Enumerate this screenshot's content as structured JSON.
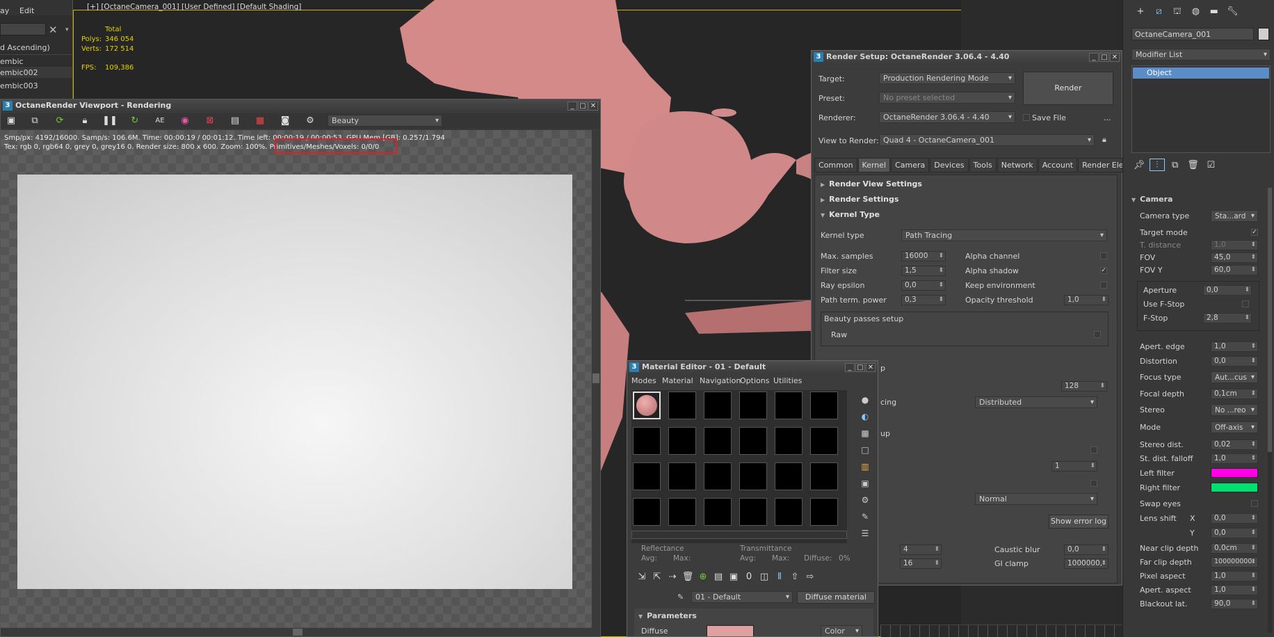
{
  "left_panel": {
    "menu": [
      "ay",
      "Edit"
    ],
    "sort_label": "d Ascending)",
    "items": [
      "embic",
      "embic002",
      "embic003"
    ]
  },
  "viewport": {
    "header": "[+] [OctaneCamera_001] [User Defined] [Default Shading]",
    "stats_total": "Total",
    "polys_label": "Polys:",
    "polys_value": "346 054",
    "verts_label": "Verts:",
    "verts_value": "172 514",
    "fps_label": "FPS:",
    "fps_value": "109,386"
  },
  "octane_viewport": {
    "title": "OctaneRender Viewport - Rendering",
    "pass": "Beauty",
    "stats_line1": "Smp/px: 4192/16000.   Samp/s: 106.6M.   Time: 00:00:19 / 00:01:12.   Time left: 00:00:19 / 00:00:53.   GPU Mem [GB]: 0.257/1.794",
    "stats_line2": "Tex: rgb 0, rgb64 0, grey 0, grey16 0.    Render size: 800 x 600.    Zoom: 100%.    Primitives/Meshes/Voxels: 0/0/0"
  },
  "render_setup": {
    "title": "Render Setup: OctaneRender 3.06.4 - 4.40",
    "target_label": "Target:",
    "target_value": "Production Rendering Mode",
    "preset_label": "Preset:",
    "preset_value": "No preset selected",
    "renderer_label": "Renderer:",
    "renderer_value": "OctaneRender 3.06.4 - 4.40",
    "save_file": "Save File",
    "view_label": "View to Render:",
    "view_value": "Quad 4 - OctaneCamera_001",
    "render_button": "Render",
    "more": "...",
    "tabs": [
      "Common",
      "Kernel",
      "Camera",
      "Devices",
      "Tools",
      "Network",
      "Account",
      "Render Elements"
    ],
    "sections": {
      "view_settings": "Render View Settings",
      "render_settings": "Render Settings",
      "kernel_type": "Kernel Type"
    },
    "kernel_type_label": "Kernel type",
    "kernel_type_value": "Path Tracing",
    "max_samples_label": "Max. samples",
    "max_samples": "16000",
    "filter_size_label": "Filter size",
    "filter_size": "1,5",
    "ray_epsilon_label": "Ray epsilon",
    "ray_epsilon": "0,0",
    "path_term_label": "Path term. power",
    "path_term": "0,3",
    "alpha_channel": "Alpha channel",
    "alpha_shadow": "Alpha shadow",
    "keep_env": "Keep environment",
    "opacity_label": "Opacity threshold",
    "opacity": "1,0",
    "beauty_passes": "Beauty passes setup",
    "raw": "Raw",
    "partial_p": "p",
    "value_128": "128",
    "partial_cing": "cing",
    "distributed": "Distributed",
    "partial_up": "up",
    "value_1": "1",
    "normal": "Normal",
    "show_error_log": "Show error log",
    "value_4": "4",
    "value_16": "16",
    "caustic_label": "Caustic blur",
    "caustic": "0,0",
    "gi_label": "GI clamp",
    "gi": "1000000,"
  },
  "material_editor": {
    "title": "Material Editor - 01 - Default",
    "menu": [
      "Modes",
      "Material",
      "Navigation",
      "Options",
      "Utilities"
    ],
    "reflectance": "Reflectance",
    "transmittance": "Transmittance",
    "avg": "Avg:",
    "max": "Max:",
    "diffuse_pct": "Diffuse:",
    "diffuse_pct_value": "0%",
    "material_name": "01 - Default",
    "material_type": "Diffuse material",
    "parameters": "Parameters",
    "diffuse_label": "Diffuse",
    "color_mode": "Color",
    "colors": {
      "swatch": "#e09a9a",
      "diffuse": "#e0a0a0"
    }
  },
  "command_panel": {
    "object_name": "OctaneCamera_001",
    "modifier_list": "Modifier List",
    "stack_item": "Object",
    "rollout": "Camera",
    "camera_type_label": "Camera type",
    "camera_type": "Sta...ard",
    "target_mode": "Target mode",
    "t_distance_label": "T. distance",
    "t_distance": "1,0",
    "fov_label": "FOV",
    "fov": "45,0",
    "fovy_label": "FOV Y",
    "fovy": "60,0",
    "aperture_label": "Aperture",
    "aperture": "0,0",
    "use_fstop": "Use F-Stop",
    "fstop_label": "F-Stop",
    "fstop": "2,8",
    "apert_edge_label": "Apert. edge",
    "apert_edge": "1,0",
    "distortion_label": "Distortion",
    "distortion": "0,0",
    "focus_type_label": "Focus type",
    "focus_type": "Aut...cus",
    "focal_depth_label": "Focal depth",
    "focal_depth": "0,1cm",
    "stereo_label": "Stereo",
    "stereo": "No ...reo",
    "mode_label": "Mode",
    "mode": "Off-axis",
    "stereo_dist_label": "Stereo dist.",
    "stereo_dist": "0,02",
    "st_falloff_label": "St. dist. falloff",
    "st_falloff": "1,0",
    "left_filter_label": "Left filter",
    "left_filter_color": "#ff00e6",
    "right_filter_label": "Right filter",
    "right_filter_color": "#00e070",
    "swap_eyes": "Swap eyes",
    "lens_shift_label": "Lens shift",
    "lens_x_label": "X",
    "lens_x": "0,0",
    "lens_y_label": "Y",
    "lens_y": "0,0",
    "near_clip_label": "Near clip depth",
    "near_clip": "0,0cm",
    "far_clip_label": "Far clip depth",
    "far_clip": "100000000",
    "pixel_aspect_label": "Pixel aspect",
    "pixel_aspect": "1,0",
    "apert_aspect_label": "Apert. aspect",
    "apert_aspect": "1,0",
    "blackout_label": "Blackout lat.",
    "blackout": "90,0"
  }
}
